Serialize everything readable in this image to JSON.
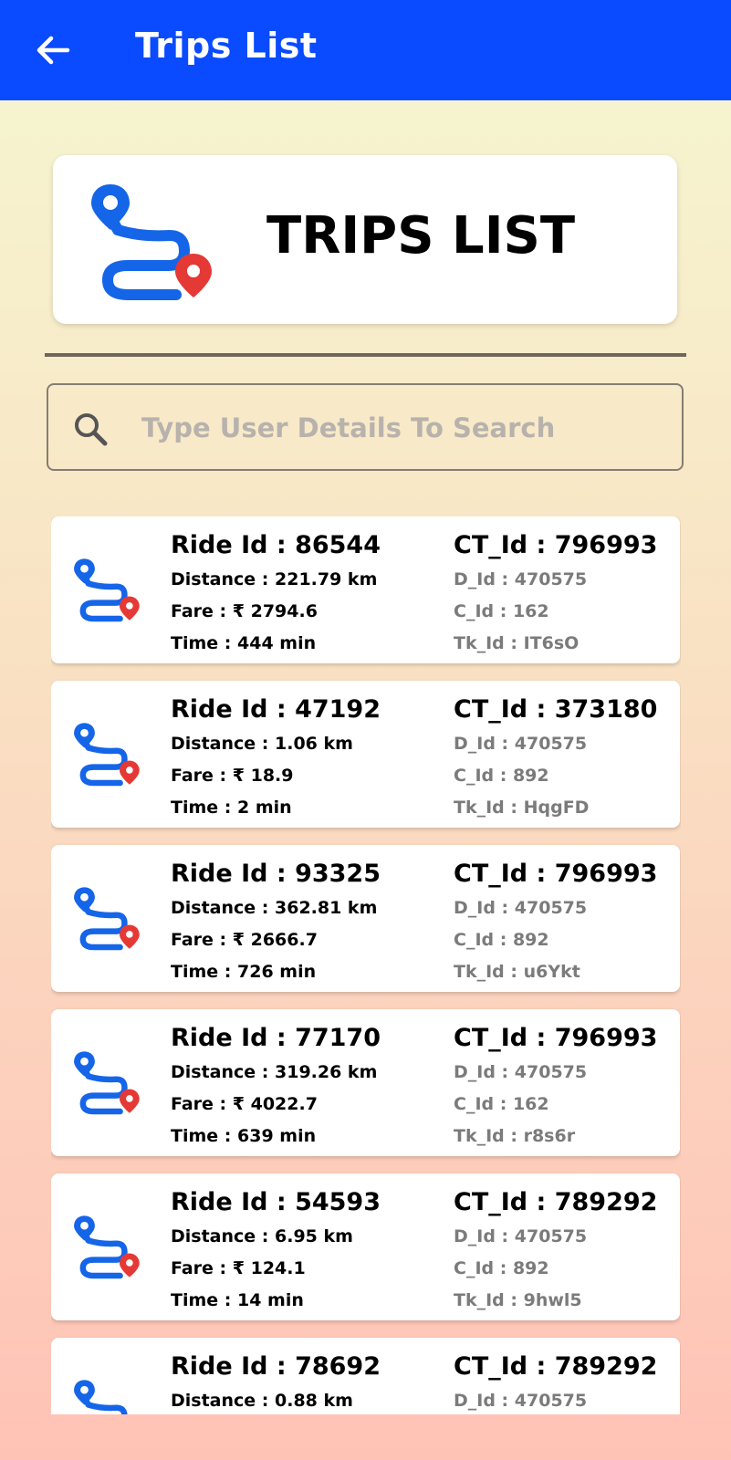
{
  "appbar": {
    "title": "Trips List",
    "back_icon": "arrow-left-icon",
    "color": "#0a4bff"
  },
  "header": {
    "title": "TRIPS LIST",
    "logo_icon": "route-icon"
  },
  "search": {
    "placeholder": "Type User Details To Search",
    "value": "",
    "icon": "search-icon"
  },
  "labels": {
    "ride_id": "Ride Id : ",
    "distance": "Distance : ",
    "fare": "Fare : ₹ ",
    "time": "Time : ",
    "ct_id": "CT_Id : ",
    "d_id": "D_Id : ",
    "c_id": "C_Id : ",
    "tk_id": "Tk_Id : "
  },
  "trips": [
    {
      "ride_id": "86544",
      "distance": "221.79 km",
      "fare": "2794.6",
      "time": "444 min",
      "ct_id": "796993",
      "d_id": "470575",
      "c_id": "162",
      "tk_id": "IT6sO"
    },
    {
      "ride_id": "47192",
      "distance": "1.06 km",
      "fare": "18.9",
      "time": "2 min",
      "ct_id": "373180",
      "d_id": "470575",
      "c_id": "892",
      "tk_id": "HqgFD"
    },
    {
      "ride_id": "93325",
      "distance": "362.81 km",
      "fare": "2666.7",
      "time": "726 min",
      "ct_id": "796993",
      "d_id": "470575",
      "c_id": "892",
      "tk_id": "u6Ykt"
    },
    {
      "ride_id": "77170",
      "distance": "319.26 km",
      "fare": "4022.7",
      "time": "639 min",
      "ct_id": "796993",
      "d_id": "470575",
      "c_id": "162",
      "tk_id": "r8s6r"
    },
    {
      "ride_id": "54593",
      "distance": "6.95 km",
      "fare": "124.1",
      "time": "14 min",
      "ct_id": "789292",
      "d_id": "470575",
      "c_id": "892",
      "tk_id": "9hwl5"
    },
    {
      "ride_id": "78692",
      "distance": "0.88 km",
      "fare": "",
      "time": "",
      "ct_id": "789292",
      "d_id": "470575",
      "c_id": "",
      "tk_id": ""
    }
  ]
}
